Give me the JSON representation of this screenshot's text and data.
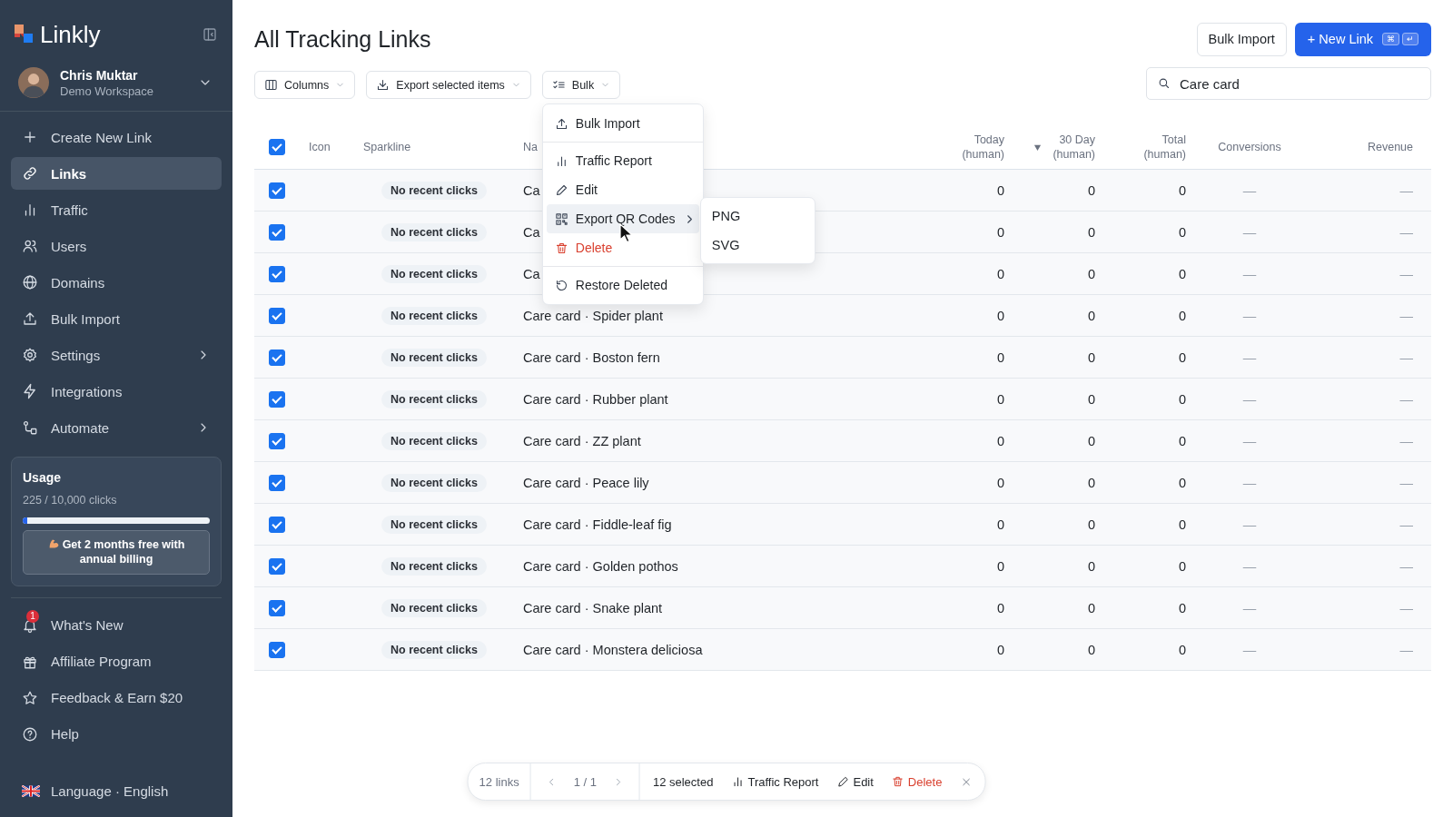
{
  "sidebar": {
    "logo": "Linkly",
    "user": {
      "name": "Chris Muktar",
      "workspace": "Demo Workspace"
    },
    "nav": [
      {
        "label": "Create New Link",
        "selected": false,
        "kind": "plain"
      },
      {
        "label": "Links",
        "selected": true,
        "kind": "plain"
      },
      {
        "label": "Traffic",
        "selected": false,
        "kind": "plain"
      },
      {
        "label": "Users",
        "selected": false,
        "kind": "plain"
      },
      {
        "label": "Domains",
        "selected": false,
        "kind": "plain"
      },
      {
        "label": "Bulk Import",
        "selected": false,
        "kind": "plain"
      },
      {
        "label": "Settings",
        "selected": false,
        "kind": "submenu"
      },
      {
        "label": "Integrations",
        "selected": false,
        "kind": "plain"
      },
      {
        "label": "Automate",
        "selected": false,
        "kind": "submenu"
      }
    ],
    "usage": {
      "title": "Usage",
      "caption": "225 / 10,000 clicks",
      "level": 0.0225,
      "promo": "Get 2 months free with annual billing"
    },
    "footer": [
      {
        "label": "What's New",
        "badge": "1"
      },
      {
        "label": "Affiliate Program"
      },
      {
        "label": "Feedback & Earn $20"
      },
      {
        "label": "Help"
      }
    ],
    "language": "Language · English"
  },
  "header": {
    "title": "All Tracking Links",
    "bulk_import": "Bulk Import",
    "new_link": "+ New Link",
    "new_link_keys": [
      "⌘",
      "↵"
    ]
  },
  "toolbar": [
    "Columns",
    "Export selected items",
    "Bulk"
  ],
  "search": {
    "value": "Care card"
  },
  "table": {
    "all_checked": true,
    "columns": [
      {
        "label": "Icon",
        "sorted": false
      },
      {
        "label": "Sparkline",
        "sorted": false
      },
      {
        "label": "Na",
        "sorted": false
      },
      {
        "label": "Today\n(human)",
        "sorted": false
      },
      {
        "label": "30 Day\n(human)",
        "sorted": true
      },
      {
        "label": "Total\n(human)",
        "sorted": false
      },
      {
        "label": "Conversions",
        "sorted": false
      },
      {
        "label": "Revenue",
        "sorted": false
      }
    ],
    "rows": [
      {
        "checked": true,
        "sparkline": "No recent clicks",
        "name": "Ca",
        "today": "0",
        "day30": "0",
        "total": "0",
        "conversions": "—",
        "revenue": "—"
      },
      {
        "checked": true,
        "sparkline": "No recent clicks",
        "name": "Ca",
        "today": "0",
        "day30": "0",
        "total": "0",
        "conversions": "—",
        "revenue": "—"
      },
      {
        "checked": true,
        "sparkline": "No recent clicks",
        "name": "Ca",
        "today": "0",
        "day30": "0",
        "total": "0",
        "conversions": "—",
        "revenue": "—"
      },
      {
        "checked": true,
        "sparkline": "No recent clicks",
        "name": "Care card · Spider plant",
        "today": "0",
        "day30": "0",
        "total": "0",
        "conversions": "—",
        "revenue": "—"
      },
      {
        "checked": true,
        "sparkline": "No recent clicks",
        "name": "Care card · Boston fern",
        "today": "0",
        "day30": "0",
        "total": "0",
        "conversions": "—",
        "revenue": "—"
      },
      {
        "checked": true,
        "sparkline": "No recent clicks",
        "name": "Care card · Rubber plant",
        "today": "0",
        "day30": "0",
        "total": "0",
        "conversions": "—",
        "revenue": "—"
      },
      {
        "checked": true,
        "sparkline": "No recent clicks",
        "name": "Care card · ZZ plant",
        "today": "0",
        "day30": "0",
        "total": "0",
        "conversions": "—",
        "revenue": "—"
      },
      {
        "checked": true,
        "sparkline": "No recent clicks",
        "name": "Care card · Peace lily",
        "today": "0",
        "day30": "0",
        "total": "0",
        "conversions": "—",
        "revenue": "—"
      },
      {
        "checked": true,
        "sparkline": "No recent clicks",
        "name": "Care card · Fiddle-leaf fig",
        "today": "0",
        "day30": "0",
        "total": "0",
        "conversions": "—",
        "revenue": "—"
      },
      {
        "checked": true,
        "sparkline": "No recent clicks",
        "name": "Care card · Golden pothos",
        "today": "0",
        "day30": "0",
        "total": "0",
        "conversions": "—",
        "revenue": "—"
      },
      {
        "checked": true,
        "sparkline": "No recent clicks",
        "name": "Care card · Snake plant",
        "today": "0",
        "day30": "0",
        "total": "0",
        "conversions": "—",
        "revenue": "—"
      },
      {
        "checked": true,
        "sparkline": "No recent clicks",
        "name": "Care card · Monstera deliciosa",
        "today": "0",
        "day30": "0",
        "total": "0",
        "conversions": "—",
        "revenue": "—"
      }
    ]
  },
  "bulk_menu": [
    {
      "label": "Bulk Import",
      "kind": "item",
      "divider_before": false,
      "selected": false
    },
    {
      "label": "Traffic Report",
      "kind": "item",
      "divider_before": true,
      "selected": false
    },
    {
      "label": "Edit",
      "kind": "item",
      "divider_before": false,
      "selected": false
    },
    {
      "label": "Export QR Codes",
      "kind": "submenu",
      "divider_before": false,
      "selected": true
    },
    {
      "label": "Delete",
      "kind": "danger",
      "divider_before": false,
      "selected": false
    },
    {
      "label": "Restore Deleted",
      "kind": "item",
      "divider_before": true,
      "selected": false
    }
  ],
  "submenu": [
    {
      "label": "PNG"
    },
    {
      "label": "SVG"
    }
  ],
  "footer_bar": {
    "count": "12 links",
    "page": "1 / 1",
    "selected": "12 selected",
    "actions": [
      {
        "label": "Traffic Report",
        "kind": "plain"
      },
      {
        "label": "Edit",
        "kind": "plain"
      },
      {
        "label": "Delete",
        "kind": "danger"
      }
    ]
  }
}
